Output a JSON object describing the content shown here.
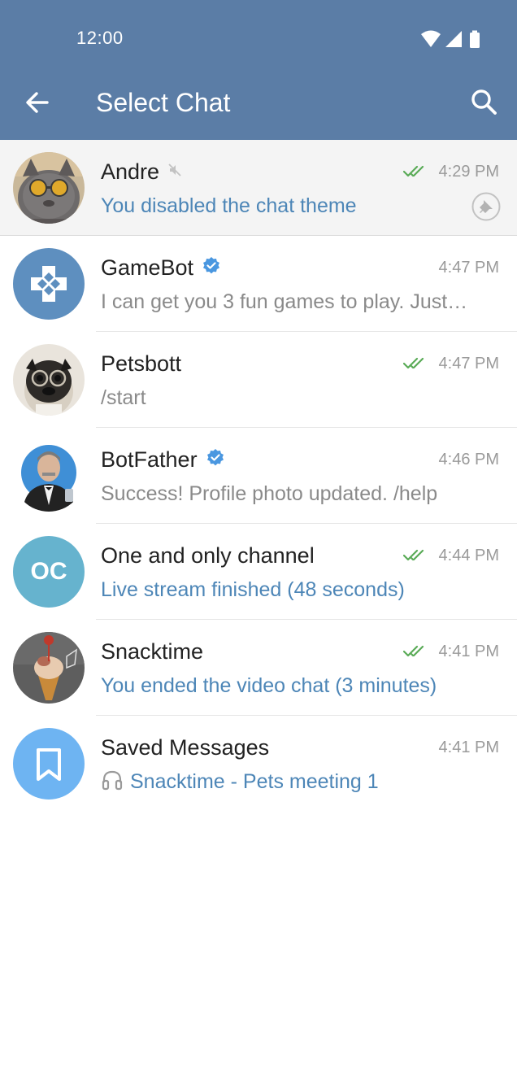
{
  "status_bar": {
    "time": "12:00"
  },
  "toolbar": {
    "title": "Select Chat",
    "back_icon": "arrow-left-icon",
    "search_icon": "search-icon"
  },
  "colors": {
    "appbar": "#5b7da6",
    "accent_blue": "#4d86b7",
    "read_tick": "#5aab57",
    "verified": "#4a97e0"
  },
  "chats": [
    {
      "name": "Andre",
      "time": "4:29 PM",
      "preview": "You disabled the chat theme",
      "preview_style": "service",
      "muted": true,
      "read": true,
      "pinned": true,
      "avatar": "cat-photo"
    },
    {
      "name": "GameBot",
      "time": "4:47 PM",
      "preview": "I can get you 3 fun games to play. Just…",
      "preview_style": "normal",
      "verified": true,
      "avatar": "gamepad-icon"
    },
    {
      "name": "Petsbott",
      "time": "4:47 PM",
      "preview": "/start",
      "preview_style": "normal",
      "read": true,
      "avatar": "pug-photo"
    },
    {
      "name": "BotFather",
      "time": "4:46 PM",
      "preview": "Success! Profile photo updated. /help",
      "preview_style": "normal",
      "verified": true,
      "avatar": "botfather-photo"
    },
    {
      "name": "One and only channel",
      "time": "4:44 PM",
      "preview": "Live stream finished (48 seconds)",
      "preview_style": "service",
      "read": true,
      "avatar_initials": "OC"
    },
    {
      "name": "Snacktime",
      "time": "4:41 PM",
      "preview": "You ended the video chat (3 minutes)",
      "preview_style": "service",
      "read": true,
      "avatar": "ice-cream-photo"
    },
    {
      "name": "Saved Messages",
      "time": "4:41 PM",
      "preview": "Snacktime - Pets meeting 1",
      "preview_style": "service",
      "preview_icon": "headphones-icon",
      "avatar": "bookmark-icon"
    }
  ]
}
